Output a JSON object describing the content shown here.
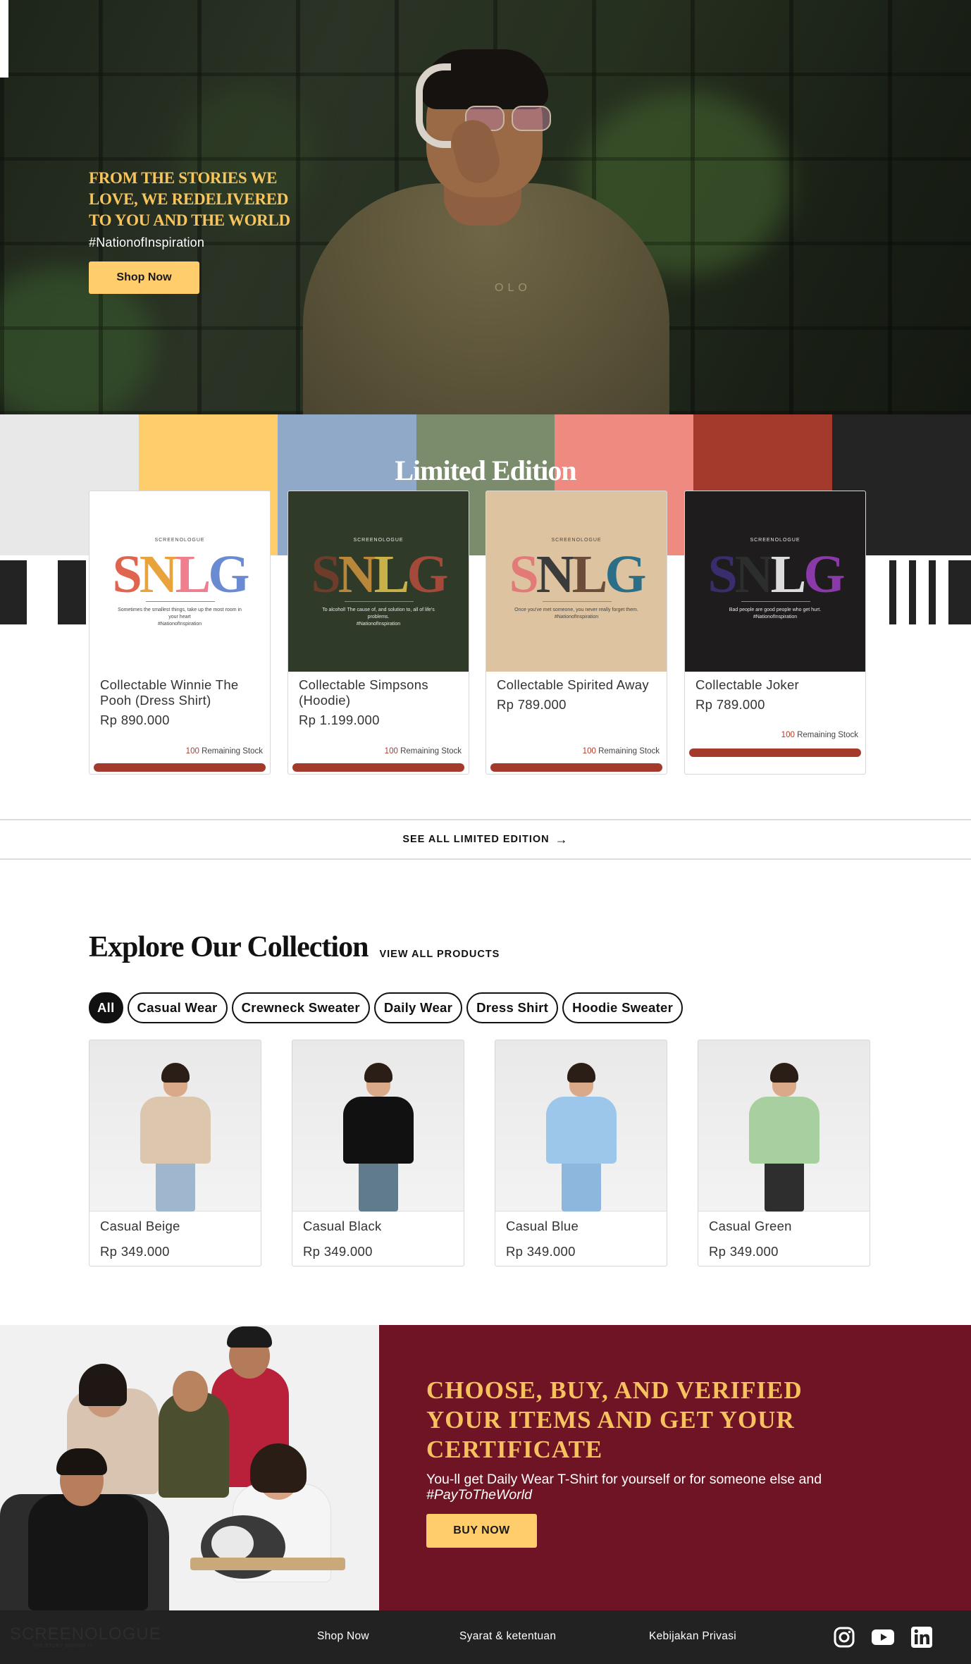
{
  "hero": {
    "title": "FROM THE STORIES WE LOVE, WE REDELIVERED TO YOU AND THE WORLD",
    "tag": "#NationofInspiration",
    "cta": "Shop Now",
    "shirt_logo": "OLO"
  },
  "limited": {
    "title": "Limited Edition",
    "stripe_colors": [
      "#e8e8e8",
      "#ffcd6b",
      "#90a9c9",
      "#7a8c6c",
      "#ee8a80",
      "#a33a2b",
      "#242424"
    ],
    "see_all": "SEE ALL LIMITED EDITION",
    "items": [
      {
        "brand": "SCREENOLOGUE",
        "quote": "Sometimes the smallest things, take up the most room in your heart",
        "signature": "#NationofInspiration",
        "name": "Collectable Winnie The Pooh (Dress Shirt)",
        "price": "Rp 890.000",
        "stock_count": "100",
        "stock_label": "Remaining Stock",
        "bg": "#ffffff"
      },
      {
        "brand": "SCREENOLOGUE",
        "quote": "To alcohol! The cause of, and solution to, all of life's problems.",
        "signature": "#NationofInspiration",
        "name": "Collectable Simpsons (Hoodie)",
        "price": "Rp 1.199.000",
        "stock_count": "100",
        "stock_label": "Remaining Stock",
        "bg": "#2f3a28"
      },
      {
        "brand": "SCREENOLOGUE",
        "quote": "Once you've met someone, you never really forget them.",
        "signature": "#NationofInspiration",
        "name": "Collectable Spirited Away",
        "price": "Rp 789.000",
        "stock_count": "100",
        "stock_label": "Remaining Stock",
        "bg": "#dec3a0"
      },
      {
        "brand": "SCREENOLOGUE",
        "quote": "Bad people are good people who get hurt.",
        "signature": "#NationofInspiration",
        "name": "Collectable Joker",
        "price": "Rp 789.000",
        "stock_count": "100",
        "stock_label": "Remaining Stock",
        "bg": "#1f1c1d"
      }
    ]
  },
  "collection": {
    "title": "Explore Our Collection",
    "view_all": "VIEW ALL PRODUCTS",
    "filters": [
      "All",
      "Casual Wear",
      "Crewneck Sweater",
      "Daily Wear",
      "Dress Shirt",
      "Hoodie Sweater"
    ],
    "active_filter": "All",
    "products": [
      {
        "name": "Casual Beige",
        "price": "Rp 349.000",
        "shirt_color": "#ddc6ae",
        "pants_color": "#9fb6cf"
      },
      {
        "name": "Casual Black",
        "price": "Rp 349.000",
        "shirt_color": "#111111",
        "pants_color": "#5f7b8c"
      },
      {
        "name": "Casual Blue",
        "price": "Rp 349.000",
        "shirt_color": "#9cc6ea",
        "pants_color": "#8eb7dd"
      },
      {
        "name": "Casual Green",
        "price": "Rp 349.000",
        "shirt_color": "#a7cf9f",
        "pants_color": "#2e2e2e"
      }
    ]
  },
  "promo": {
    "title": "CHOOSE, BUY, AND VERIFIED YOUR ITEMS AND GET YOUR CERTIFICATE",
    "text": "You-ll get Daily Wear T-Shirt for yourself or for someone else and",
    "hashtag": "#PayToTheWorld",
    "cta": "BUY NOW"
  },
  "footer": {
    "logo": "SCREENOLOGUE",
    "logo_sub": "THE STORY BEHIND IT",
    "links": [
      "Shop Now",
      "Syarat & ketentuan",
      "Kebijakan Privasi"
    ],
    "social": [
      "instagram-icon",
      "youtube-icon",
      "linkedin-icon"
    ]
  }
}
